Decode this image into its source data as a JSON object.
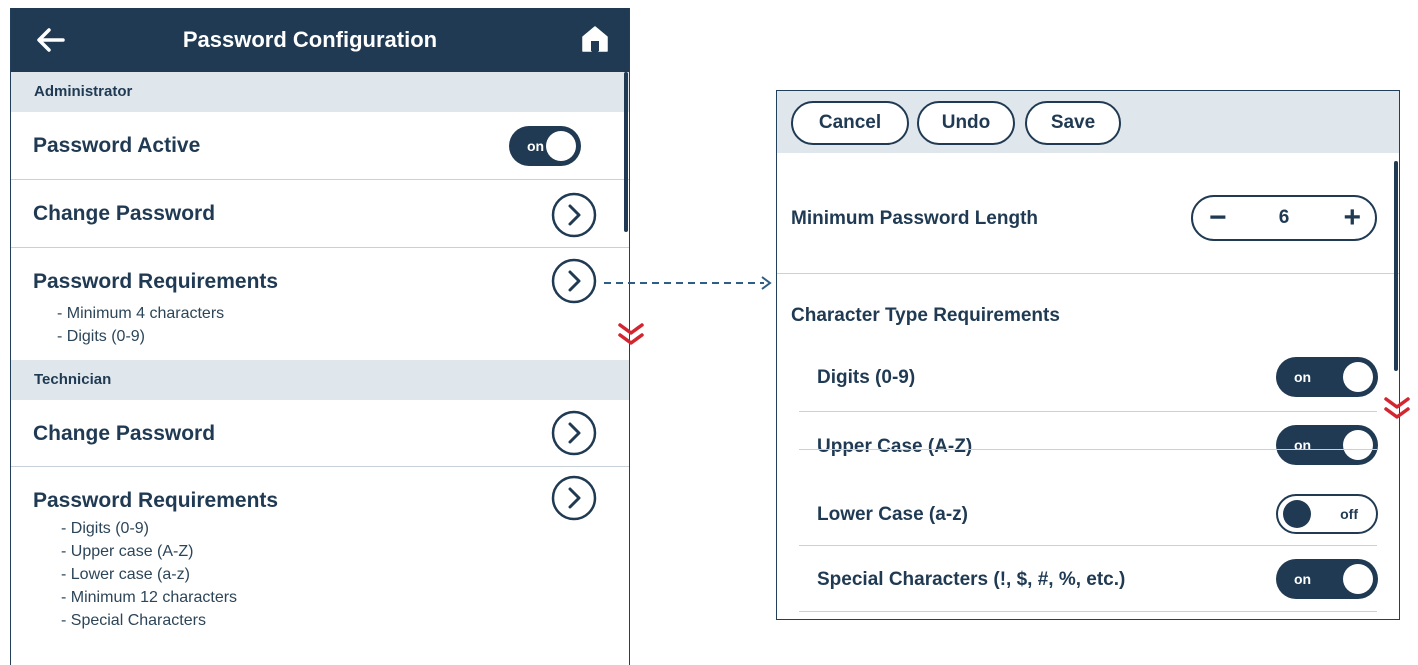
{
  "left_panel": {
    "title": "Password Configuration",
    "admin": {
      "header": "Administrator",
      "password_active_label": "Password Active",
      "password_active_state": "on",
      "change_password_label": "Change Password",
      "requirements_label": "Password Requirements",
      "requirements": [
        "- Minimum 4 characters",
        "- Digits (0-9)"
      ]
    },
    "technician": {
      "header": "Technician",
      "change_password_label": "Change Password",
      "requirements_label": "Password Requirements",
      "requirements": [
        "- Digits (0-9)",
        "- Upper case (A-Z)",
        "- Lower case (a-z)",
        "- Minimum 12 characters",
        "- Special Characters"
      ]
    }
  },
  "right_panel": {
    "buttons": {
      "cancel": "Cancel",
      "undo": "Undo",
      "save": "Save"
    },
    "min_length_label": "Minimum Password Length",
    "min_length_value": "6",
    "stepper_minus": "−",
    "stepper_plus": "+",
    "char_type_header": "Character Type Requirements",
    "toggles": [
      {
        "label": "Digits (0-9)",
        "state": "on"
      },
      {
        "label": "Upper Case (A-Z)",
        "state": "on"
      },
      {
        "label": "Lower Case (a-z)",
        "state": "off"
      },
      {
        "label": "Special Characters (!, $, #, %, etc.)",
        "state": "on"
      }
    ]
  },
  "icons": {
    "back": "back-arrow-icon",
    "home": "home-icon",
    "chevron": "chevron-right-circle-icon",
    "scroll_hint": "double-chevron-down-icon"
  },
  "colors": {
    "primary": "#1f3a52",
    "section_bg": "#dfe6ec",
    "accent_red": "#d22630",
    "connector": "#2f5d86"
  }
}
